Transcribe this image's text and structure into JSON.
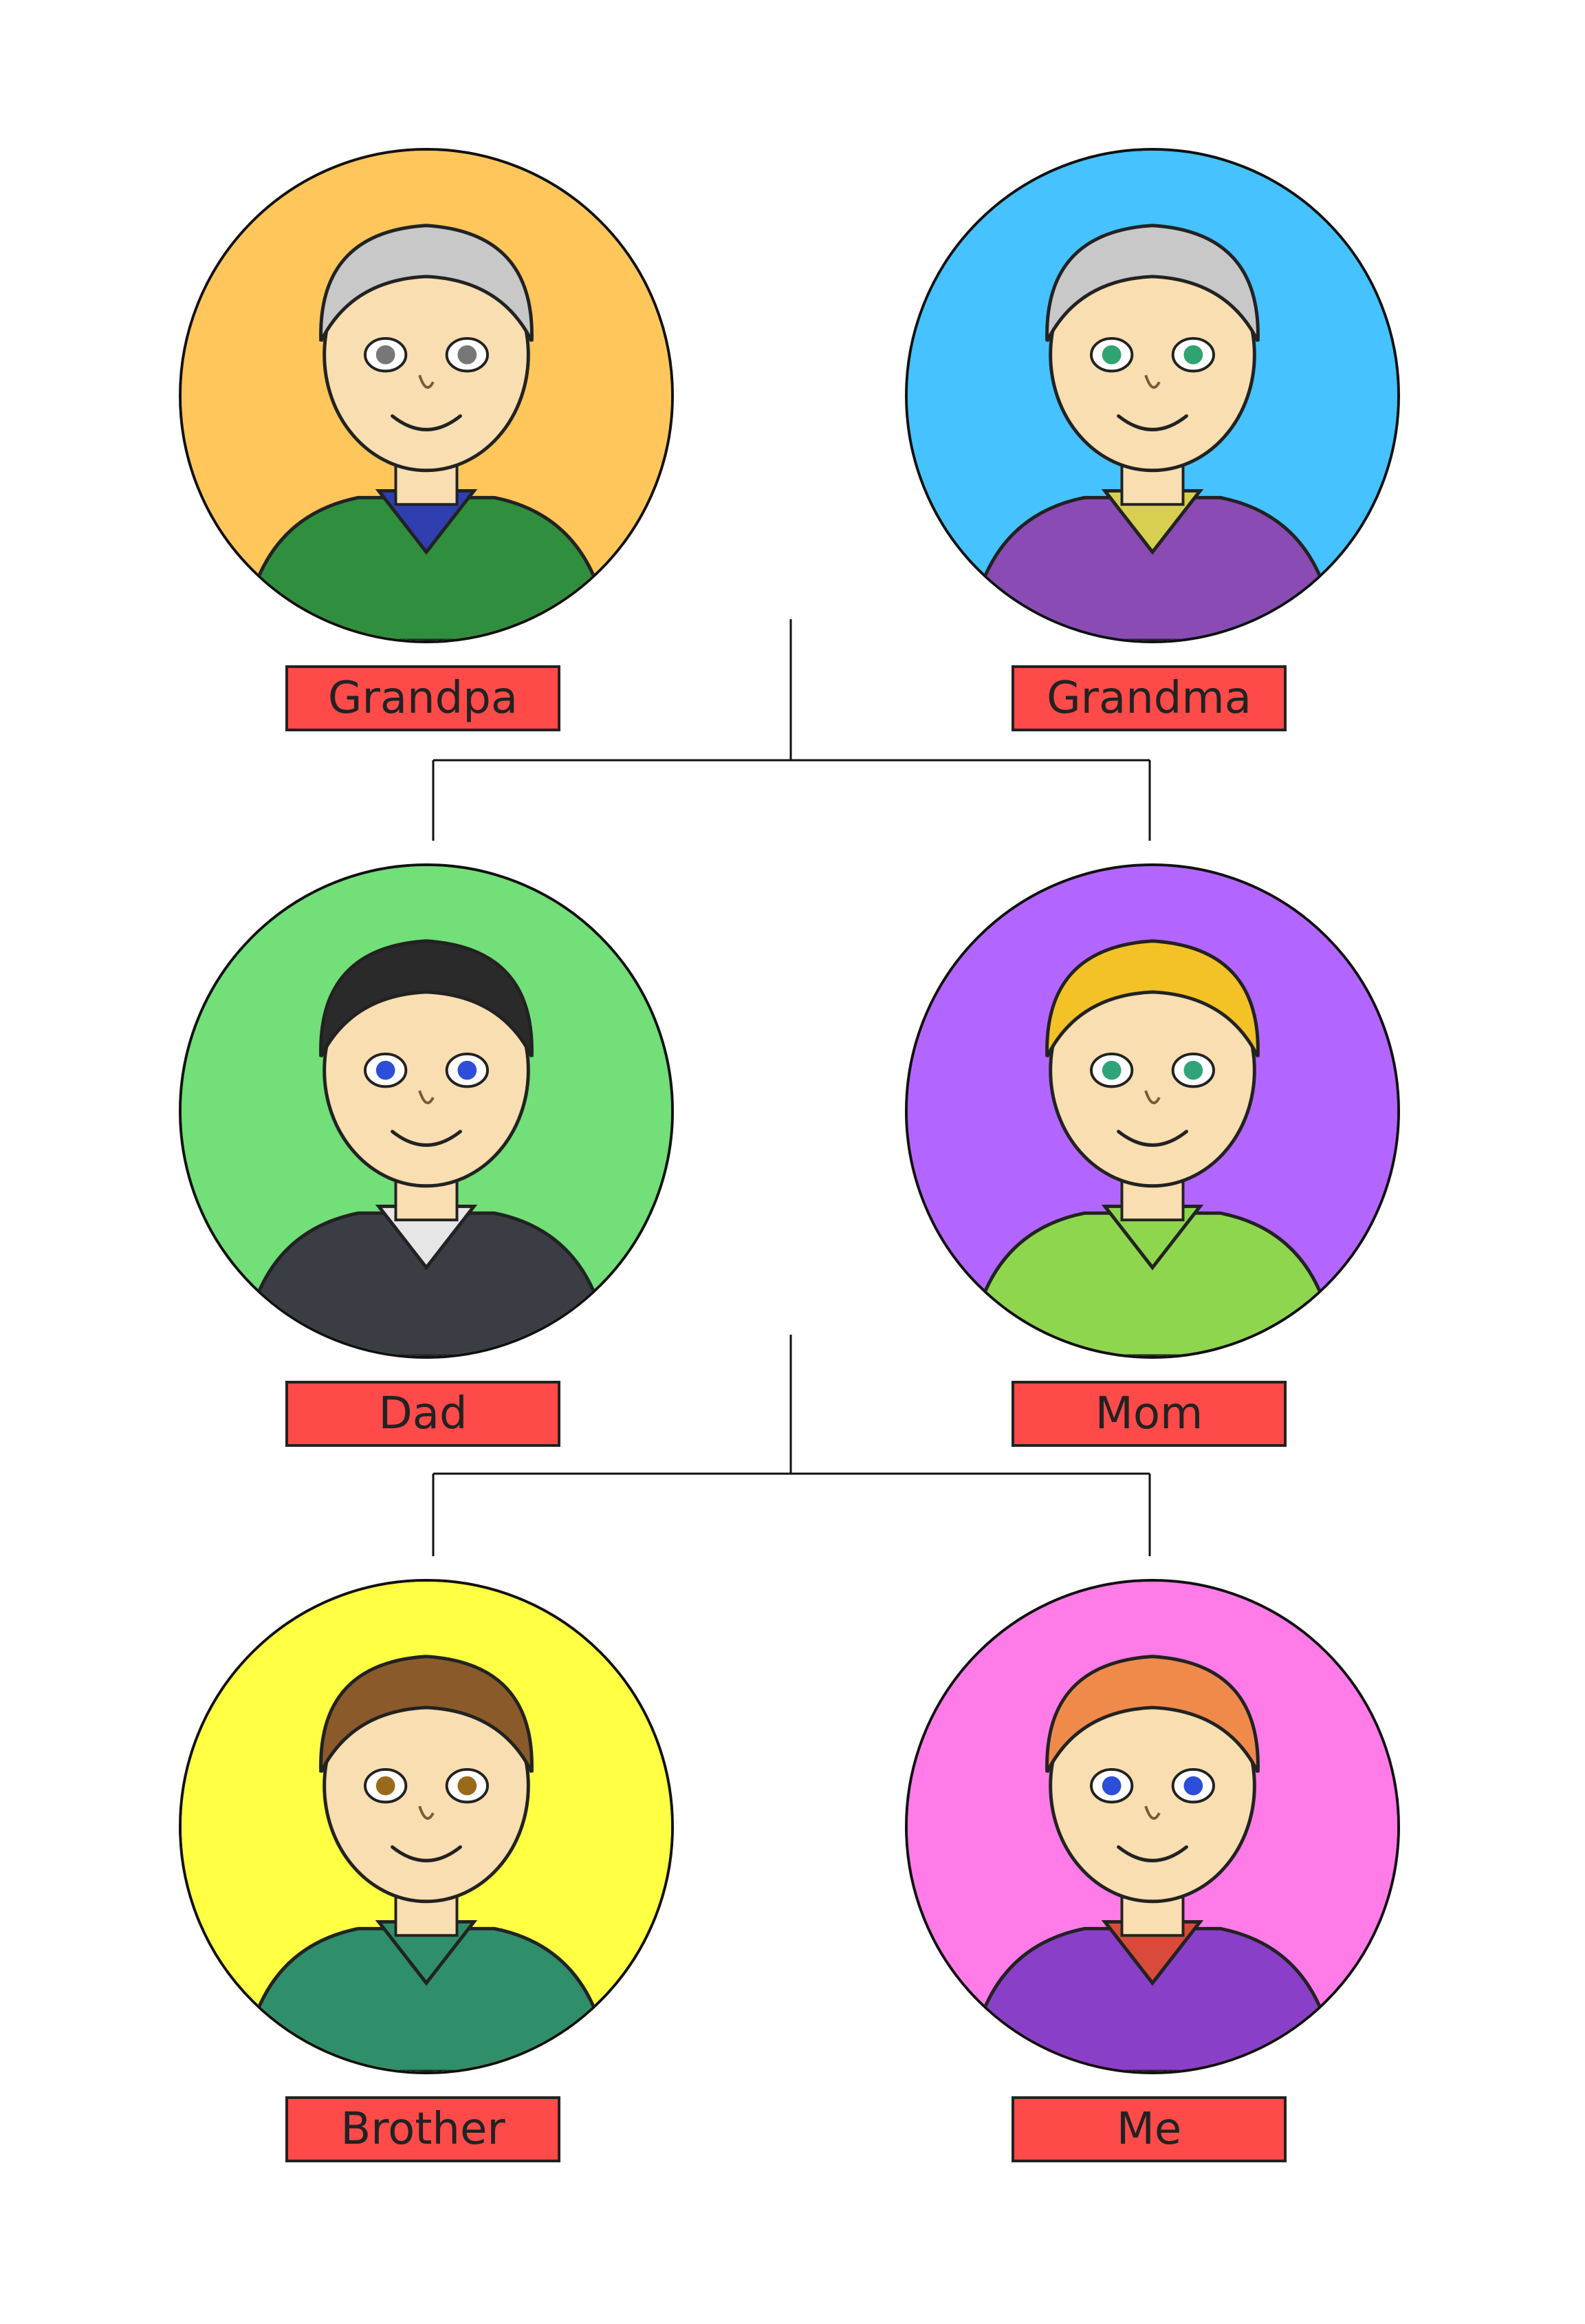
{
  "family_tree": {
    "generations": [
      {
        "members": [
          {
            "id": "grandpa",
            "label": "Grandpa",
            "bg": "#ffc65c",
            "shirt": "#2f8f3e",
            "collar": "#2f3fb0",
            "hair": "#c8c8c8",
            "eyes": "#777777"
          },
          {
            "id": "grandma",
            "label": "Grandma",
            "bg": "#45c2ff",
            "shirt": "#8a4bb5",
            "collar": "#d8cf52",
            "hair": "#c8c8c8",
            "eyes": "#2fa372"
          }
        ]
      },
      {
        "members": [
          {
            "id": "dad",
            "label": "Dad",
            "bg": "#72df78",
            "shirt": "#3a3d44",
            "collar": "#e6e6e6",
            "hair": "#2a2a2a",
            "eyes": "#2c4ed8"
          },
          {
            "id": "mom",
            "label": "Mom",
            "bg": "#b366ff",
            "shirt": "#8fd64f",
            "collar": "#8fd64f",
            "hair": "#f3c227",
            "eyes": "#2fa37a"
          }
        ]
      },
      {
        "members": [
          {
            "id": "brother",
            "label": "Brother",
            "bg": "#ffff44",
            "shirt": "#2f8f6a",
            "collar": "#2f8f6a",
            "hair": "#8b5a2b",
            "eyes": "#9a6a1c"
          },
          {
            "id": "me",
            "label": "Me",
            "bg": "#ff7be8",
            "shirt": "#8a3fc8",
            "collar": "#d94a3a",
            "hair": "#f08a4b",
            "eyes": "#2c4ed8"
          }
        ]
      }
    ]
  },
  "colors": {
    "label_bg": "#ff4a4a",
    "outline": "#111111",
    "line": "#111111",
    "skin": "#f8deb0"
  }
}
